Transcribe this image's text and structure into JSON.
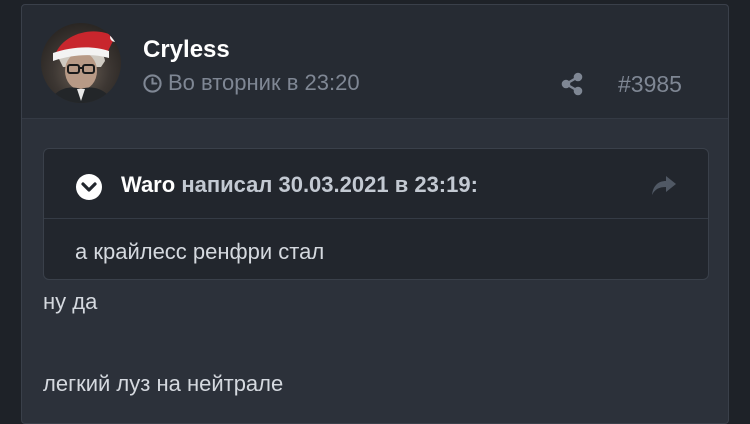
{
  "post": {
    "author": "Cryless",
    "date": "Во вторник в 23:20",
    "post_number": "#3985",
    "quote": {
      "author": "Waro",
      "meta": "написал 30.03.2021 в 23:19:",
      "text": "а крайлесс ренфри стал"
    },
    "message_lines": [
      "ну да",
      "легкий луз на нейтрале"
    ]
  },
  "icons": {
    "avatar": "avatar-santa-hat",
    "date": "clock-icon",
    "share": "share-icon",
    "quote_toggle": "chevron-down-circle-icon",
    "quote_jump": "reply-arrow-icon"
  },
  "colors": {
    "page_bg": "#1e2228",
    "post_bg": "#2c313a",
    "header_bg": "#262b33",
    "quote_bg": "#22262d",
    "muted_text": "#7f8794",
    "santa_hat_red": "#c8262d"
  }
}
